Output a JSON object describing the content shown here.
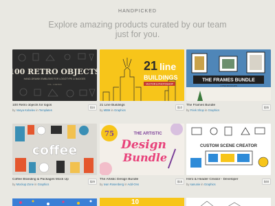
{
  "header": {
    "eyebrow": "HANDPICKED",
    "headline": "Explore amazing products curated by our team just for you."
  },
  "products": [
    {
      "title": "100 Retro objects for logos",
      "by_prefix": "by",
      "author": "Vasya Kobelev",
      "in_word": "in",
      "category": "Templates",
      "price": "$16",
      "thumb_text": {
        "line1": "100 RETRO OBJECTS",
        "line2": "HAND-DRAWN EMBLEMS FOR LOGOTYPE & BADGES",
        "line3": "VOL. 1 RETRO"
      }
    },
    {
      "title": "21 Line Buildings",
      "by_prefix": "by",
      "author": "MBM",
      "in_word": "in",
      "category": "Graphics",
      "price": "$10",
      "thumb_text": {
        "line1": "21",
        "line2": "line",
        "line3": "BUILDINGS",
        "line4": "VECTOR & PHOTOSHOP"
      }
    },
    {
      "title": "The Frames Bundle",
      "by_prefix": "by",
      "author": "Friek Shop",
      "in_word": "in",
      "category": "Graphics",
      "price": "$35",
      "thumb_text": {
        "line1": "THE FRAMES BUNDLE",
        "line2": "4 PSD MOCKUPS"
      }
    },
    {
      "title": "Coffee Branding & Packages Mock Up",
      "by_prefix": "by",
      "author": "Mockup Zone",
      "in_word": "in",
      "category": "Graphics",
      "price": "$29",
      "thumb_text": {
        "line1": "coffee"
      }
    },
    {
      "title": "The Artistic Design Bundle",
      "by_prefix": "by",
      "author": "Ivan Rosenberg",
      "in_word": "in",
      "category": "Add-Ons",
      "price": "$15",
      "thumb_text": {
        "line1": "75",
        "line2": "THE ARTISTIC",
        "line3": "Design",
        "line4": "Bundle"
      }
    },
    {
      "title": "Hero & Header Creator - Developer",
      "by_prefix": "by",
      "author": "sanunie",
      "in_word": "in",
      "category": "Graphics",
      "price": "$48",
      "thumb_text": {
        "line1": "CUSTOM SCENE CREATOR"
      }
    }
  ],
  "partial_row": [
    {
      "thumb_text": "10"
    }
  ],
  "colors": {
    "background": "#e9e8e2",
    "link": "#2d7fb2",
    "yellow": "#f7c51a",
    "dark_thumb": "#2a2a2a"
  }
}
